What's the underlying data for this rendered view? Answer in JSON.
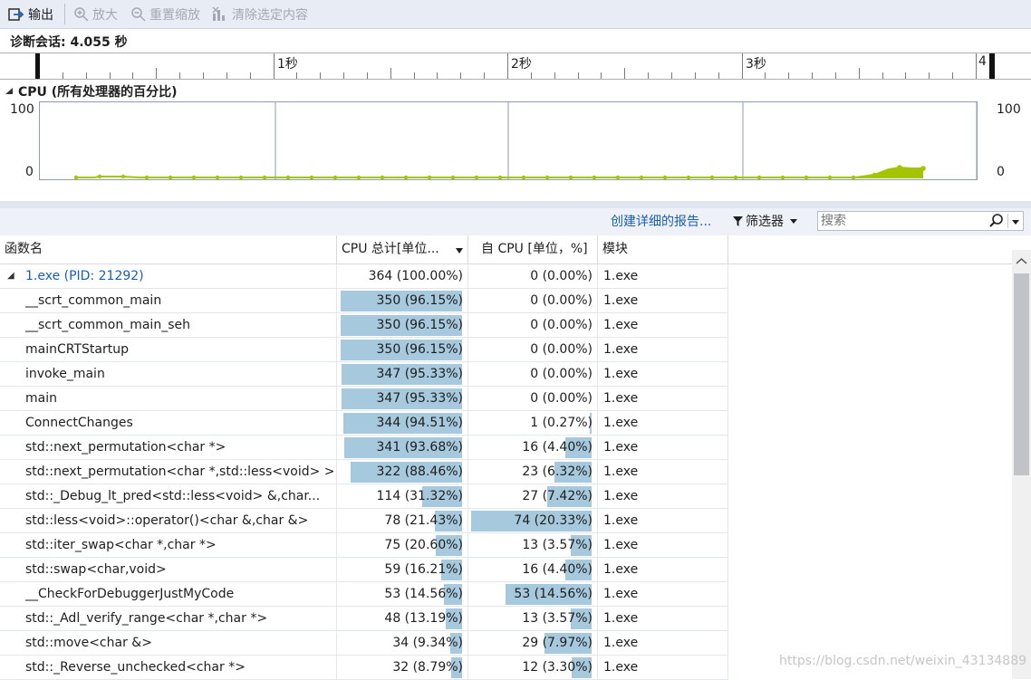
{
  "toolbar": {
    "export_label": "输出",
    "zoom_in_label": "放大",
    "reset_zoom_label": "重置缩放",
    "clear_selection_label": "清除选定内容"
  },
  "session": {
    "label": "诊断会话: 4.055 秒"
  },
  "timeline": {
    "labels": [
      "1秒",
      "2秒",
      "3秒",
      "4"
    ]
  },
  "cpu_chart": {
    "title": "CPU (所有处理器的百分比)",
    "y_max": "100",
    "y_min": "0",
    "line_color": "#a4c400"
  },
  "actions": {
    "report_link": "创建详细的报告...",
    "filter_label": "筛选器",
    "search_placeholder": "搜索"
  },
  "table": {
    "headers": {
      "name": "函数名",
      "total": "CPU 总计[单位...",
      "self": "自 CPU [单位，%]",
      "module": "模块"
    },
    "rows": [
      {
        "name": "1.exe (PID: 21292)",
        "total": "364 (100.00%)",
        "total_pct": 100.0,
        "self": "0 (0.00%)",
        "self_pct": 0.0,
        "module": "1.exe"
      },
      {
        "name": "__scrt_common_main",
        "total": "350 (96.15%)",
        "total_pct": 96.15,
        "self": "0 (0.00%)",
        "self_pct": 0.0,
        "module": "1.exe"
      },
      {
        "name": "__scrt_common_main_seh",
        "total": "350 (96.15%)",
        "total_pct": 96.15,
        "self": "0 (0.00%)",
        "self_pct": 0.0,
        "module": "1.exe"
      },
      {
        "name": "mainCRTStartup",
        "total": "350 (96.15%)",
        "total_pct": 96.15,
        "self": "0 (0.00%)",
        "self_pct": 0.0,
        "module": "1.exe"
      },
      {
        "name": "invoke_main",
        "total": "347 (95.33%)",
        "total_pct": 95.33,
        "self": "0 (0.00%)",
        "self_pct": 0.0,
        "module": "1.exe"
      },
      {
        "name": "main",
        "total": "347 (95.33%)",
        "total_pct": 95.33,
        "self": "0 (0.00%)",
        "self_pct": 0.0,
        "module": "1.exe"
      },
      {
        "name": "ConnectChanges",
        "total": "344 (94.51%)",
        "total_pct": 94.51,
        "self": "1 (0.27%)",
        "self_pct": 0.27,
        "module": "1.exe"
      },
      {
        "name": "std::next_permutation<char *>",
        "total": "341 (93.68%)",
        "total_pct": 93.68,
        "self": "16 (4.40%)",
        "self_pct": 4.4,
        "module": "1.exe"
      },
      {
        "name": "std::next_permutation<char *,std::less<void> >",
        "total": "322 (88.46%)",
        "total_pct": 88.46,
        "self": "23 (6.32%)",
        "self_pct": 6.32,
        "module": "1.exe"
      },
      {
        "name": "std::_Debug_lt_pred<std::less<void> &,char...",
        "total": "114 (31.32%)",
        "total_pct": 31.32,
        "self": "27 (7.42%)",
        "self_pct": 7.42,
        "module": "1.exe"
      },
      {
        "name": "std::less<void>::operator()<char &,char &>",
        "total": "78 (21.43%)",
        "total_pct": 21.43,
        "self": "74 (20.33%)",
        "self_pct": 20.33,
        "module": "1.exe"
      },
      {
        "name": "std::iter_swap<char *,char *>",
        "total": "75 (20.60%)",
        "total_pct": 20.6,
        "self": "13 (3.57%)",
        "self_pct": 3.57,
        "module": "1.exe"
      },
      {
        "name": "std::swap<char,void>",
        "total": "59 (16.21%)",
        "total_pct": 16.21,
        "self": "16 (4.40%)",
        "self_pct": 4.4,
        "module": "1.exe"
      },
      {
        "name": "__CheckForDebuggerJustMyCode",
        "total": "53 (14.56%)",
        "total_pct": 14.56,
        "self": "53 (14.56%)",
        "self_pct": 14.56,
        "module": "1.exe"
      },
      {
        "name": "std::_Adl_verify_range<char *,char *>",
        "total": "48 (13.19%)",
        "total_pct": 13.19,
        "self": "13 (3.57%)",
        "self_pct": 3.57,
        "module": "1.exe"
      },
      {
        "name": "std::move<char &>",
        "total": "34 (9.34%)",
        "total_pct": 9.34,
        "self": "29 (7.97%)",
        "self_pct": 7.97,
        "module": "1.exe"
      },
      {
        "name": "std::_Reverse_unchecked<char *>",
        "total": "32 (8.79%)",
        "total_pct": 8.79,
        "self": "12 (3.30%)",
        "self_pct": 3.3,
        "module": "1.exe"
      }
    ]
  },
  "watermark": "https://blog.csdn.net/weixin_43134889"
}
